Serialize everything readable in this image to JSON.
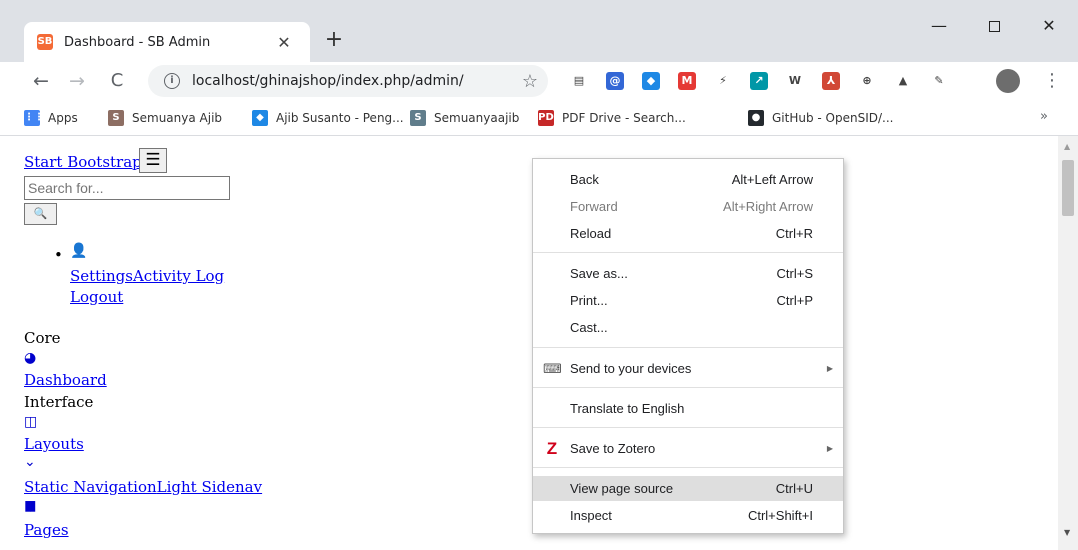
{
  "browser": {
    "tab": {
      "title": "Dashboard - SB Admin",
      "favicon": "SB",
      "close": "✕"
    },
    "new_tab": "+",
    "window": {
      "minimize": "—",
      "close": "✕"
    },
    "nav": {
      "back": "←",
      "forward": "→",
      "reload": "C"
    },
    "address": {
      "info": "i",
      "url": "localhost/ghinajshop/index.php/admin/",
      "star": "☆"
    },
    "extensions": [
      {
        "name": "doc-icon",
        "glyph": "▤",
        "color": "#e8e8e8"
      },
      {
        "name": "at-icon",
        "glyph": "@",
        "color": "#3367d6"
      },
      {
        "name": "diamond-icon",
        "glyph": "◆",
        "color": "#1e88e5"
      },
      {
        "name": "red-square-icon",
        "glyph": "M",
        "color": "#e53935"
      },
      {
        "name": "bolt-icon",
        "glyph": "⚡",
        "color": "#ffffff"
      },
      {
        "name": "cyan-icon",
        "glyph": "↗",
        "color": "#0097a7"
      },
      {
        "name": "word-icon",
        "glyph": "W",
        "color": "#ffffff"
      },
      {
        "name": "pdf-icon",
        "glyph": "⅄",
        "color": "#d14836"
      },
      {
        "name": "circle-icon",
        "glyph": "⊕",
        "color": "#ffffff"
      },
      {
        "name": "drive-icon",
        "glyph": "▲",
        "color": "#ffffff"
      },
      {
        "name": "feather-icon",
        "glyph": "✎",
        "color": "#ffffff"
      }
    ],
    "menu_kebab": "⋮",
    "bookmarks": [
      {
        "label": "Apps",
        "glyph": "⋮⋮",
        "color": "#4285f4"
      },
      {
        "label": "Semuanya Ajib",
        "glyph": "S",
        "color": "#8d6e63"
      },
      {
        "label": "Ajib Susanto - Peng...",
        "glyph": "◆",
        "color": "#1e88e5"
      },
      {
        "label": "Semuanyaajib",
        "glyph": "S",
        "color": "#607d8b"
      },
      {
        "label": "PDF Drive - Search...",
        "glyph": "PD",
        "color": "#c62828"
      },
      {
        "label": "GitHub - OpenSID/...",
        "glyph": "●",
        "color": "#24292e"
      }
    ],
    "bookmarks_more": "»"
  },
  "page": {
    "brand": "Start Bootstrap",
    "toggle": "☰",
    "search_placeholder": "Search for...",
    "search_button": "🔍",
    "user_bullet": "•",
    "user_icon": "👤",
    "settings": "Settings",
    "activity_log": "Activity Log",
    "logout": "Logout",
    "core_heading": "Core",
    "dashboard_icon": "◕",
    "dashboard": "Dashboard",
    "interface_heading": "Interface",
    "layouts_icon": "◫",
    "layouts": "Layouts",
    "chevron": "⌄",
    "static_navigation": "Static Navigation",
    "light_sidenav": "Light Sidenav",
    "pages_icon": "▮▮",
    "pages": "Pages"
  },
  "context_menu": {
    "back": {
      "label": "Back",
      "shortcut": "Alt+Left Arrow"
    },
    "forward": {
      "label": "Forward",
      "shortcut": "Alt+Right Arrow"
    },
    "reload": {
      "label": "Reload",
      "shortcut": "Ctrl+R"
    },
    "save_as": {
      "label": "Save as...",
      "shortcut": "Ctrl+S"
    },
    "print": {
      "label": "Print...",
      "shortcut": "Ctrl+P"
    },
    "cast": {
      "label": "Cast..."
    },
    "send_devices": {
      "label": "Send to your devices",
      "icon": "⌨"
    },
    "translate": {
      "label": "Translate to English"
    },
    "zotero": {
      "label": "Save to Zotero",
      "icon": "Z"
    },
    "view_source": {
      "label": "View page source",
      "shortcut": "Ctrl+U"
    },
    "inspect": {
      "label": "Inspect",
      "shortcut": "Ctrl+Shift+I"
    },
    "submenu_arrow": "▶"
  },
  "colors": {
    "zotero_red": "#d0021b",
    "highlight": "#dedede",
    "link": "#0000ee"
  }
}
